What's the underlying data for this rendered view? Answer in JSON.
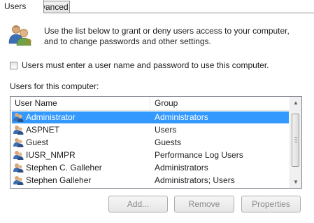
{
  "tabs": [
    {
      "label": "Users"
    },
    {
      "label": "Advanced"
    }
  ],
  "intro": {
    "line1": "Use the list below to grant or deny users access to your computer,",
    "line2": "and to change passwords and other settings."
  },
  "checkbox": {
    "label": "Users must enter a user name and password to use this computer.",
    "checked": false
  },
  "users_section_label": "Users for this computer:",
  "list": {
    "columns": [
      "User Name",
      "Group"
    ],
    "rows": [
      {
        "name": "Administrator",
        "group": "Administrators",
        "selected": true
      },
      {
        "name": "ASPNET",
        "group": "Users"
      },
      {
        "name": "Guest",
        "group": "Guests"
      },
      {
        "name": "IUSR_NMPR",
        "group": "Performance Log Users"
      },
      {
        "name": "Stephen C. Galleher",
        "group": "Administrators"
      },
      {
        "name": "Stephen Galleher",
        "group": "Administrators; Users"
      }
    ]
  },
  "buttons": {
    "add": "Add...",
    "remove": "Remove",
    "properties": "Properties"
  },
  "icons": {
    "users_icon": "users-group-icon",
    "row_icon": "user-icon"
  },
  "colors": {
    "selection": "#3399ff",
    "border": "#828790"
  }
}
